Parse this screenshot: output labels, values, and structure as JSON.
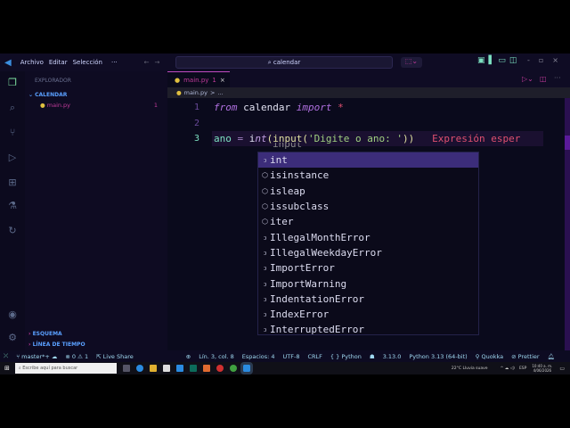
{
  "titlebar": {
    "menus": [
      "Archivo",
      "Editar",
      "Selección",
      "···"
    ],
    "search": "calendar"
  },
  "sidebar": {
    "title": "EXPLORADOR",
    "folder": "CALENDAR",
    "file": "main.py",
    "file_badge": "1",
    "sections": [
      "ESQUEMA",
      "LÍNEA DE TIEMPO"
    ]
  },
  "editor": {
    "tab": "main.py",
    "tab_badge": "1",
    "breadcrumb": [
      "main.py",
      ">",
      "..."
    ],
    "lines": [
      {
        "n": "1"
      },
      {
        "n": "2"
      },
      {
        "n": "3"
      }
    ],
    "line1": {
      "kw": "from",
      "mod": " calendar ",
      "imp": "import",
      "star": " *"
    },
    "line3": {
      "var": "ano",
      "eq": " = ",
      "i": "i",
      "nt": "nt",
      "rest": "(input(",
      "str": "'Digite o ano: '",
      "close": "))",
      "error": "Expresión esper"
    },
    "suggest_hidden": "input",
    "suggestions": [
      "int",
      "isinstance",
      "isleap",
      "issubclass",
      "iter",
      "IllegalMonthError",
      "IllegalWeekdayError",
      "ImportError",
      "ImportWarning",
      "IndentationError",
      "IndexError",
      "InterruptedError"
    ]
  },
  "status": {
    "branch": "master*+",
    "errors": "0",
    "warnings": "1",
    "liveshare": "Live Share",
    "position": "Lín. 3, col. 8",
    "spaces": "Espacios: 4",
    "encoding": "UTF-8",
    "eol": "CRLF",
    "lang": "Python",
    "version": "3.13.0",
    "interpreter": "Python 3.13 (64-bit)",
    "quokka": "Quokka",
    "prettier": "Prettier"
  },
  "taskbar": {
    "search": "Escribe aquí para buscar",
    "weather": "22°C  Lluvia suave",
    "lang": "ESP",
    "time": "10:40 a. m.",
    "date": "4/06/2026"
  }
}
